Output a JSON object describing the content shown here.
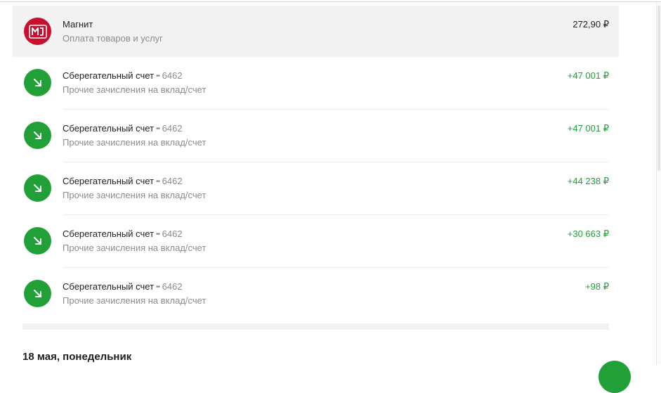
{
  "transactions": [
    {
      "merchant": "Магнит",
      "account_mask": "",
      "category": "Оплата товаров и услуг",
      "amount": "272,90 ₽",
      "icon": "magnit-logo-icon",
      "type": "expense",
      "color": "#c8102e"
    },
    {
      "merchant": "Сберегательный счет",
      "account_mask": "6462",
      "category": "Прочие зачисления на вклад/счет",
      "amount": "+47 001 ₽",
      "icon": "incoming-arrow-icon",
      "type": "income",
      "color": "#21a038"
    },
    {
      "merchant": "Сберегательный счет",
      "account_mask": "6462",
      "category": "Прочие зачисления на вклад/счет",
      "amount": "+47 001 ₽",
      "icon": "incoming-arrow-icon",
      "type": "income",
      "color": "#21a038"
    },
    {
      "merchant": "Сберегательный счет",
      "account_mask": "6462",
      "category": "Прочие зачисления на вклад/счет",
      "amount": "+44 238 ₽",
      "icon": "incoming-arrow-icon",
      "type": "income",
      "color": "#21a038"
    },
    {
      "merchant": "Сберегательный счет",
      "account_mask": "6462",
      "category": "Прочие зачисления на вклад/счет",
      "amount": "+30 663 ₽",
      "icon": "incoming-arrow-icon",
      "type": "income",
      "color": "#21a038"
    },
    {
      "merchant": "Сберегательный счет",
      "account_mask": "6462",
      "category": "Прочие зачисления на вклад/счет",
      "amount": "+98 ₽",
      "icon": "incoming-arrow-icon",
      "type": "income",
      "color": "#21a038"
    }
  ],
  "next_group": {
    "date_label": "18 мая, понедельник"
  },
  "colors": {
    "accent_green": "#21a038",
    "brand_red": "#c8102e",
    "text_secondary": "#8c8c8c",
    "row_highlight": "#f2f2f2"
  }
}
